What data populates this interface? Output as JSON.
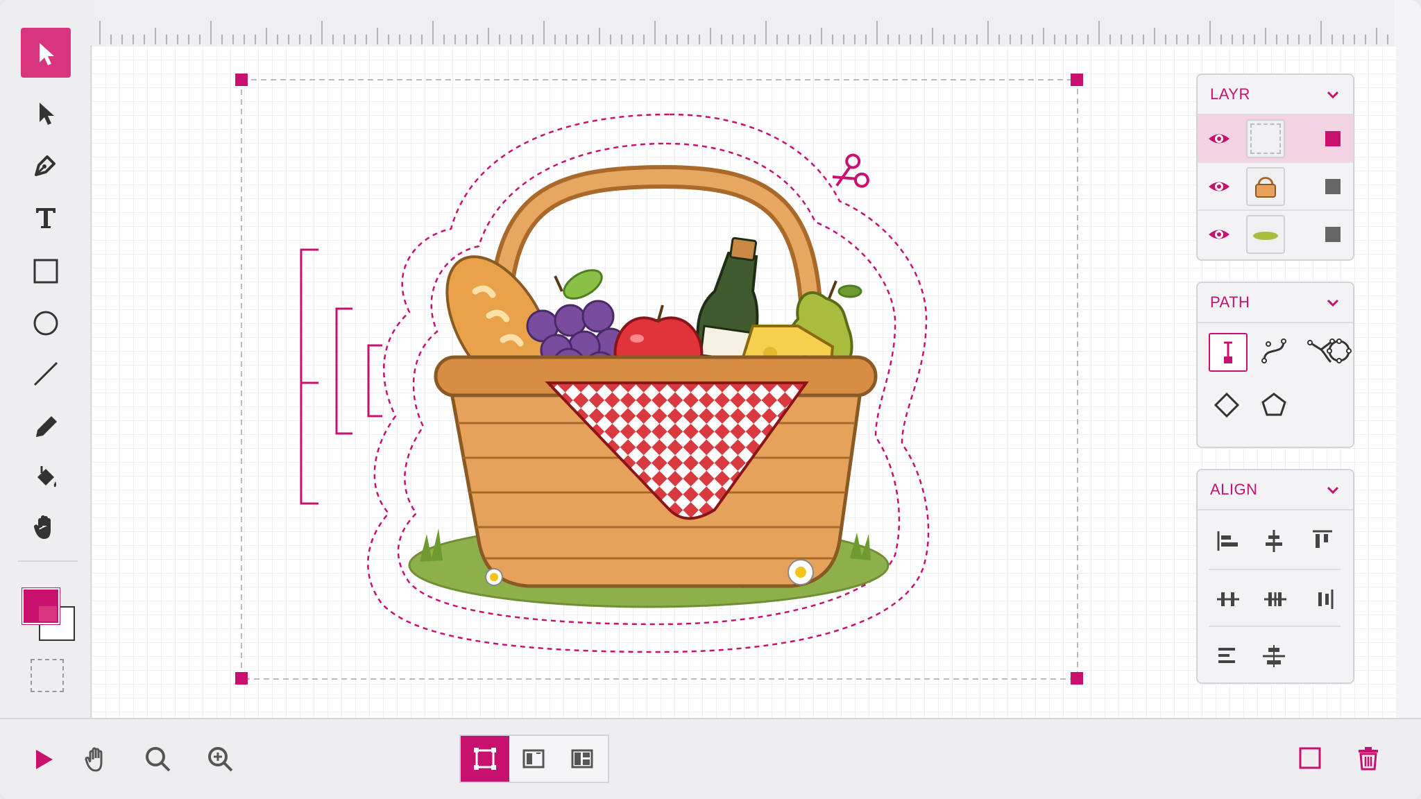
{
  "tools": [
    {
      "name": "selection-tool",
      "icon": "selection-arrow-icon",
      "active": true
    },
    {
      "name": "direct-select-tool",
      "icon": "direct-select-icon"
    },
    {
      "name": "pen-tool",
      "icon": "pen-nib-icon"
    },
    {
      "name": "type-tool",
      "icon": "text-icon"
    },
    {
      "name": "rectangle-tool",
      "icon": "rectangle-icon"
    },
    {
      "name": "ellipse-tool",
      "icon": "circle-icon"
    },
    {
      "name": "line-tool",
      "icon": "line-icon"
    },
    {
      "name": "pencil-tool",
      "icon": "pencil-icon"
    },
    {
      "name": "fill-tool",
      "icon": "paint-bucket-icon"
    },
    {
      "name": "hand-tool",
      "icon": "hand-icon"
    }
  ],
  "colors": {
    "accent": "#c8106f",
    "fill": "#c8106f",
    "stroke": "#ffffff"
  },
  "panels": {
    "layers": {
      "title": "LAYR",
      "rows": [
        {
          "name": "cut-line-layer",
          "visible": true,
          "selected": true
        },
        {
          "name": "basket-layer",
          "visible": true,
          "selected": false
        },
        {
          "name": "ground-layer",
          "visible": true,
          "selected": false
        }
      ]
    },
    "path": {
      "title": "PATH",
      "tools": [
        "anchor-point-icon",
        "curve-icon",
        "node-convert-icon",
        "circle-nodes-icon",
        "diamond-nodes-icon",
        "pentagon-nodes-icon"
      ]
    },
    "align": {
      "title": "ALIGN",
      "tools": [
        "align-left-icon",
        "align-center-horizontal-icon",
        "align-top-icon",
        "distribute-left-icon",
        "distribute-center-icon",
        "distribute-right-icon",
        "align-text-left-icon",
        "align-middle-icon"
      ]
    }
  },
  "bottombar": {
    "tools": [
      "play-icon",
      "hand-icon",
      "zoom-icon",
      "zoom-in-icon"
    ],
    "views": [
      "artboard-view-icon",
      "split-view-icon",
      "grid-view-icon"
    ],
    "active_view": "artboard-view-icon",
    "right": [
      "frame-icon",
      "trash-icon"
    ]
  }
}
